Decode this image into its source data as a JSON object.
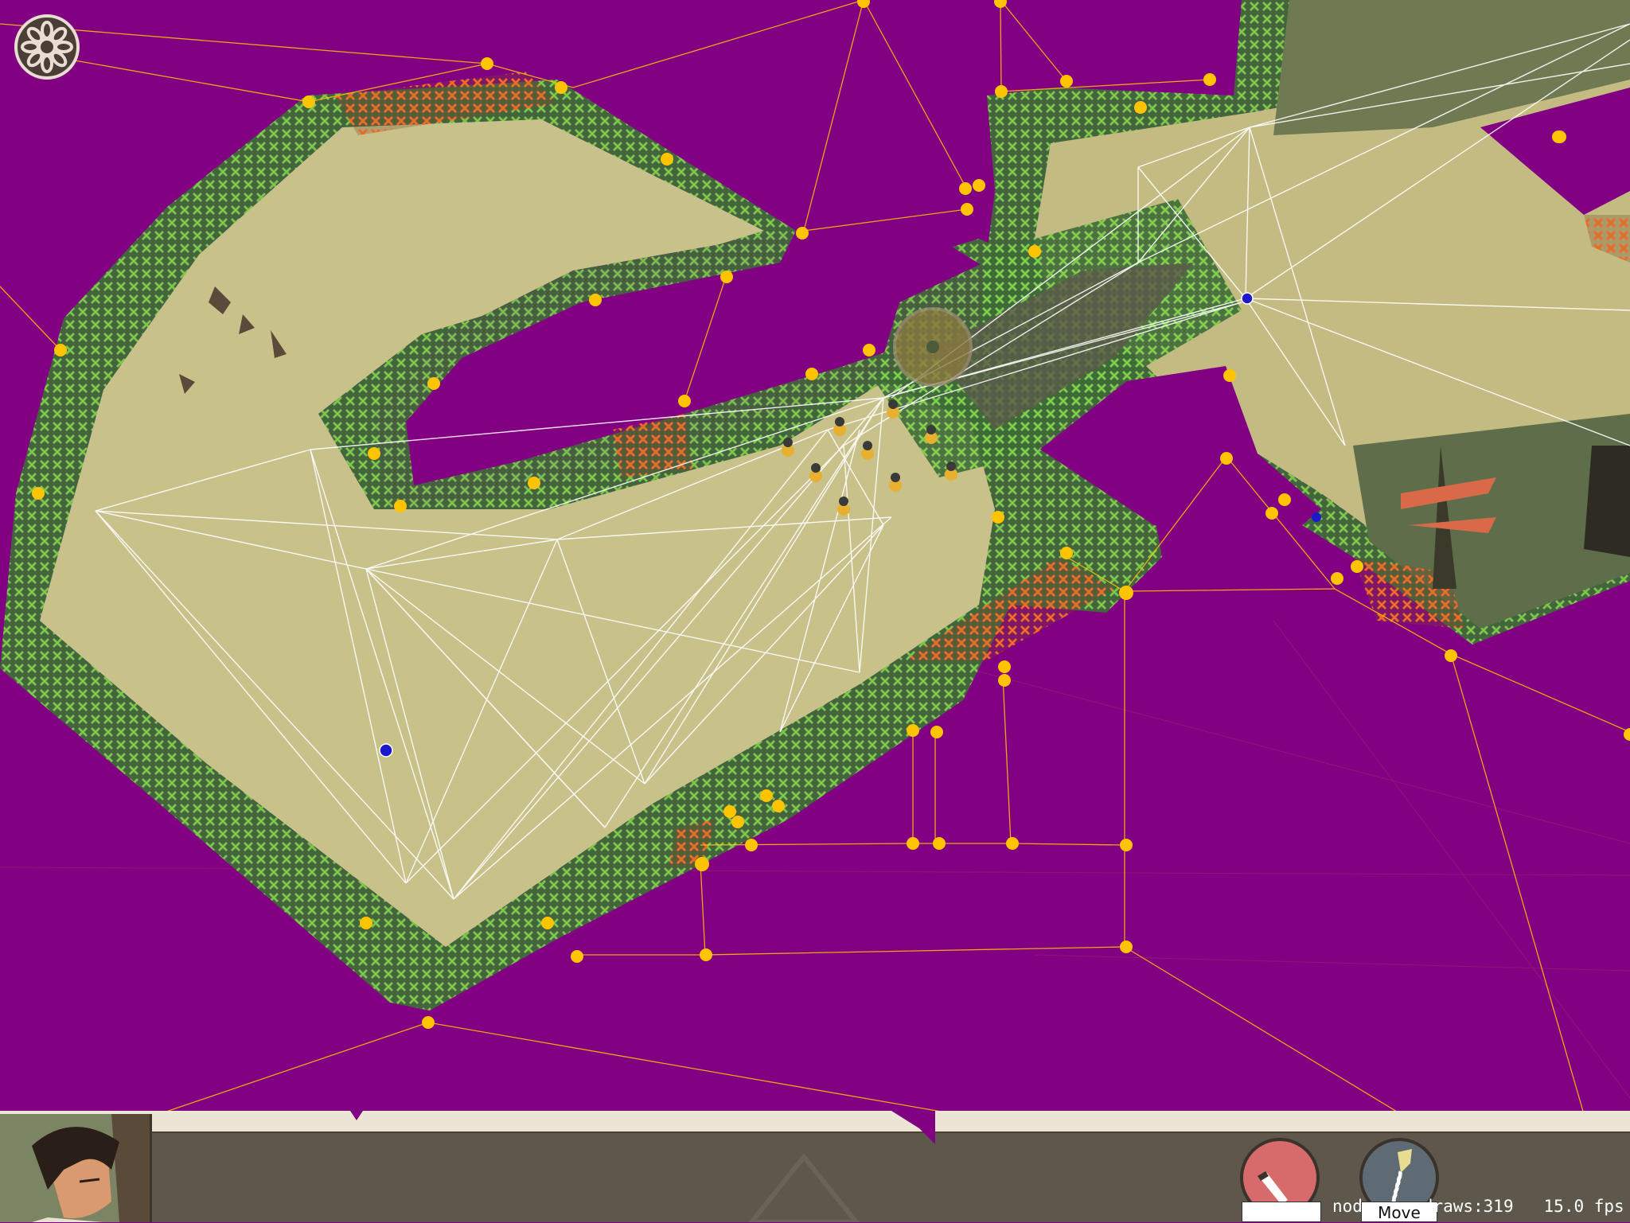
{
  "hud": {
    "move_label": "Move",
    "attack_label": "",
    "debug_prefix": "nod",
    "debug_draws": "draws:319",
    "debug_fps": "15.0 fps"
  },
  "icons": {
    "settings": "gear-icon",
    "attack": "sword-icon",
    "move": "dagger-icon"
  },
  "colors": {
    "background": "#820082",
    "navmesh_node": "#ffc400",
    "walkable_marker": "#7ccc4a",
    "blocked_marker": "#ec6a28",
    "ground": "#c9c18a",
    "hud_bar": "#5e574b",
    "hud_trim": "#ece4d5",
    "attack_button": "#d76a6a",
    "move_button": "#5f6b74"
  }
}
